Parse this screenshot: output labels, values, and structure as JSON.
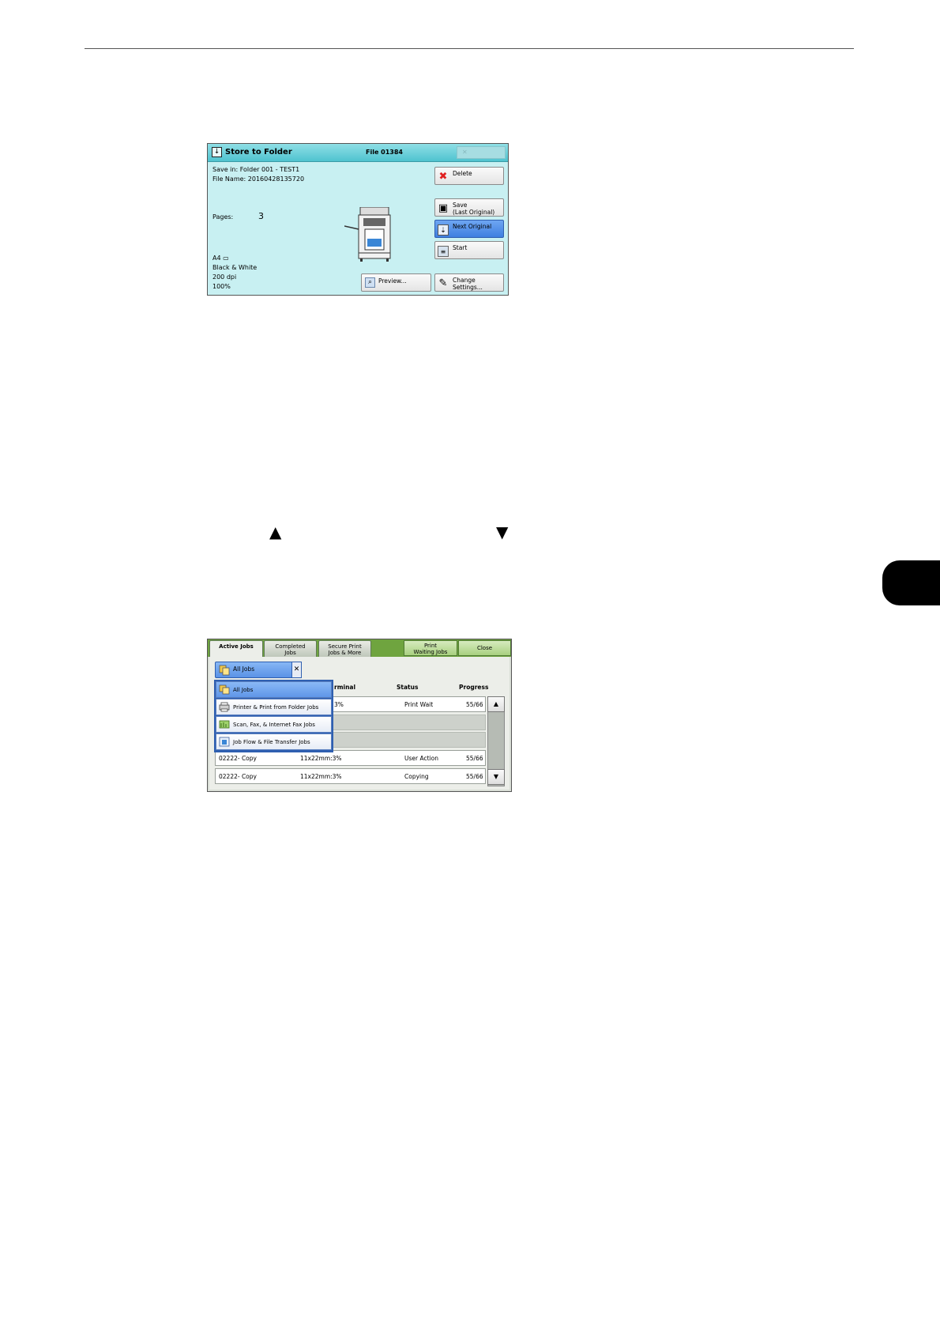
{
  "page": {
    "up_arrow": "▲",
    "down_arrow": "▼"
  },
  "store_screen": {
    "title": "Store to Folder",
    "file_number": "File 01384",
    "save_in": "Save in: Folder 001 - TEST1",
    "file_name": "File Name: 20160428135720",
    "pages_label": "Pages:",
    "pages_value": "3",
    "paper_size": "A4 ▭",
    "color_mode": "Black & White",
    "resolution": "200 dpi",
    "scale": "100%",
    "buttons": {
      "delete": "Delete",
      "save": "Save\n(Last Original)",
      "next_original": "Next Original",
      "start": "Start",
      "change_settings": "Change\nSettings...",
      "preview": "Preview..."
    },
    "colors": {
      "background": "#c8f0f2",
      "titlebar": "#4fc3cf",
      "accent": "#3e7fe0"
    }
  },
  "job_screen": {
    "tabs": {
      "active_jobs": "Active Jobs",
      "completed_jobs": "Completed\nJobs",
      "secure_print": "Secure Print\nJobs & More",
      "print_waiting": "Print\nWaiting Jobs",
      "close": "Close"
    },
    "filter": {
      "selected": "All Jobs"
    },
    "columns": {
      "terminal": "rminal",
      "status": "Status",
      "progress": "Progress"
    },
    "dropdown": [
      {
        "label": "All Jobs",
        "icon": "all-jobs-icon"
      },
      {
        "label": "Printer & Print from Folder Jobs",
        "icon": "printer-icon"
      },
      {
        "label": "Scan, Fax, & Internet Fax Jobs",
        "icon": "scan-icon"
      },
      {
        "label": "Job Flow & File Transfer Jobs",
        "icon": "job-flow-icon"
      }
    ],
    "rows": [
      {
        "job": "",
        "size": "3%",
        "status": "Print Wait",
        "progress": "55/66"
      },
      {
        "job": "",
        "size": "",
        "status": "",
        "progress": ""
      },
      {
        "job": "",
        "size": "",
        "status": "",
        "progress": ""
      },
      {
        "job": "02222- Copy",
        "size": "11x22mm:3%",
        "status": "User Action",
        "progress": "55/66"
      },
      {
        "job": "02222- Copy",
        "size": "11x22mm:3%",
        "status": "Copying",
        "progress": "55/66"
      }
    ],
    "scroll_up": "▲",
    "scroll_down": "▼",
    "colors": {
      "topbar": "#6fa43f",
      "selection": "#5f96e8"
    }
  }
}
